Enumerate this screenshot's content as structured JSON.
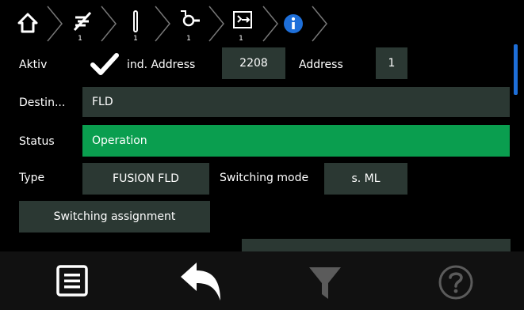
{
  "breadcrumbs": [
    {
      "icon": "home-icon",
      "sub": ""
    },
    {
      "icon": "no-signal-icon",
      "sub": "1"
    },
    {
      "icon": "detector-icon",
      "sub": "1"
    },
    {
      "icon": "sensor-icon",
      "sub": "1"
    },
    {
      "icon": "module-exit-icon",
      "sub": "1"
    },
    {
      "icon": "info-icon",
      "sub": ""
    }
  ],
  "row_active": {
    "label": "Aktiv",
    "checked": true,
    "ind_address_label": "ind. Address",
    "ind_address_value": "2208",
    "address_label": "Address",
    "address_value": "1"
  },
  "row_destination": {
    "label": "Destin...",
    "value": "FLD"
  },
  "row_status": {
    "label": "Status",
    "value": "Operation"
  },
  "row_type": {
    "label": "Type",
    "value": "FUSION FLD",
    "switching_mode_label": "Switching mode",
    "switching_mode_value": "s. ML"
  },
  "switching_assignment_button": "Switching assignment",
  "footer": [
    "list-icon",
    "back-icon",
    "filter-icon",
    "help-icon"
  ],
  "colors": {
    "field": "#2b3833",
    "status_ok": "#0a9e4f",
    "scroll": "#1e6fd9",
    "info": "#1e6fd9"
  }
}
